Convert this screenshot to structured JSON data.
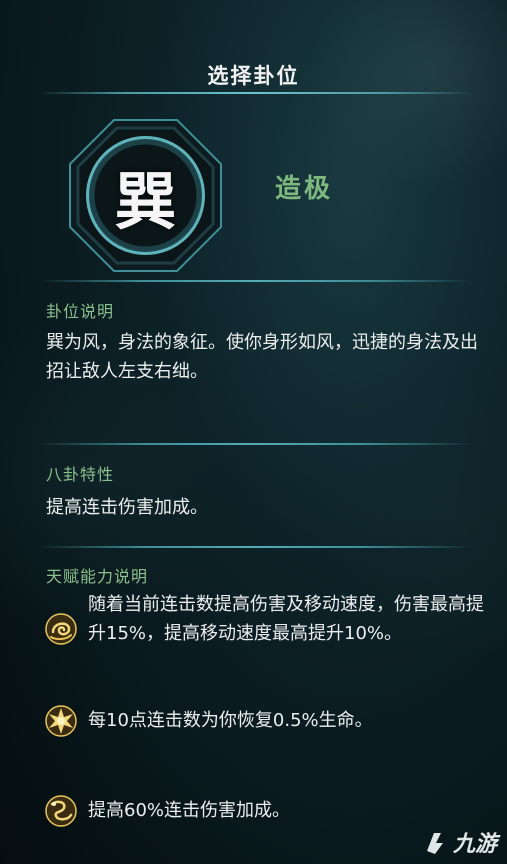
{
  "header": {
    "title": "选择卦位"
  },
  "trigram": {
    "character": "巽",
    "talent_name": "造极"
  },
  "sections": {
    "description": {
      "title": "卦位说明",
      "text": "巽为风，身法的象征。使你身形如风，迅捷的身法及出招让敌人左支右绌。"
    },
    "trait": {
      "title": "八卦特性",
      "text": "提高连击伤害加成。"
    },
    "talents": {
      "title": "天赋能力说明",
      "items": [
        {
          "icon": "swirl-wind-icon",
          "text": "随着当前连击数提高伤害及移动速度，伤害最高提升15%，提高移动速度最高提升10%。"
        },
        {
          "icon": "burst-spark-icon",
          "text": "每10点连击数为你恢复0.5%生命。"
        },
        {
          "icon": "wind-dragon-icon",
          "text": "提高60%连击伤害加成。"
        }
      ]
    }
  },
  "watermark": {
    "text": "九游"
  },
  "colors": {
    "accent_green": "#7fb87f",
    "divider_teal": "#56aab4",
    "icon_gold": "#e8c45a"
  }
}
